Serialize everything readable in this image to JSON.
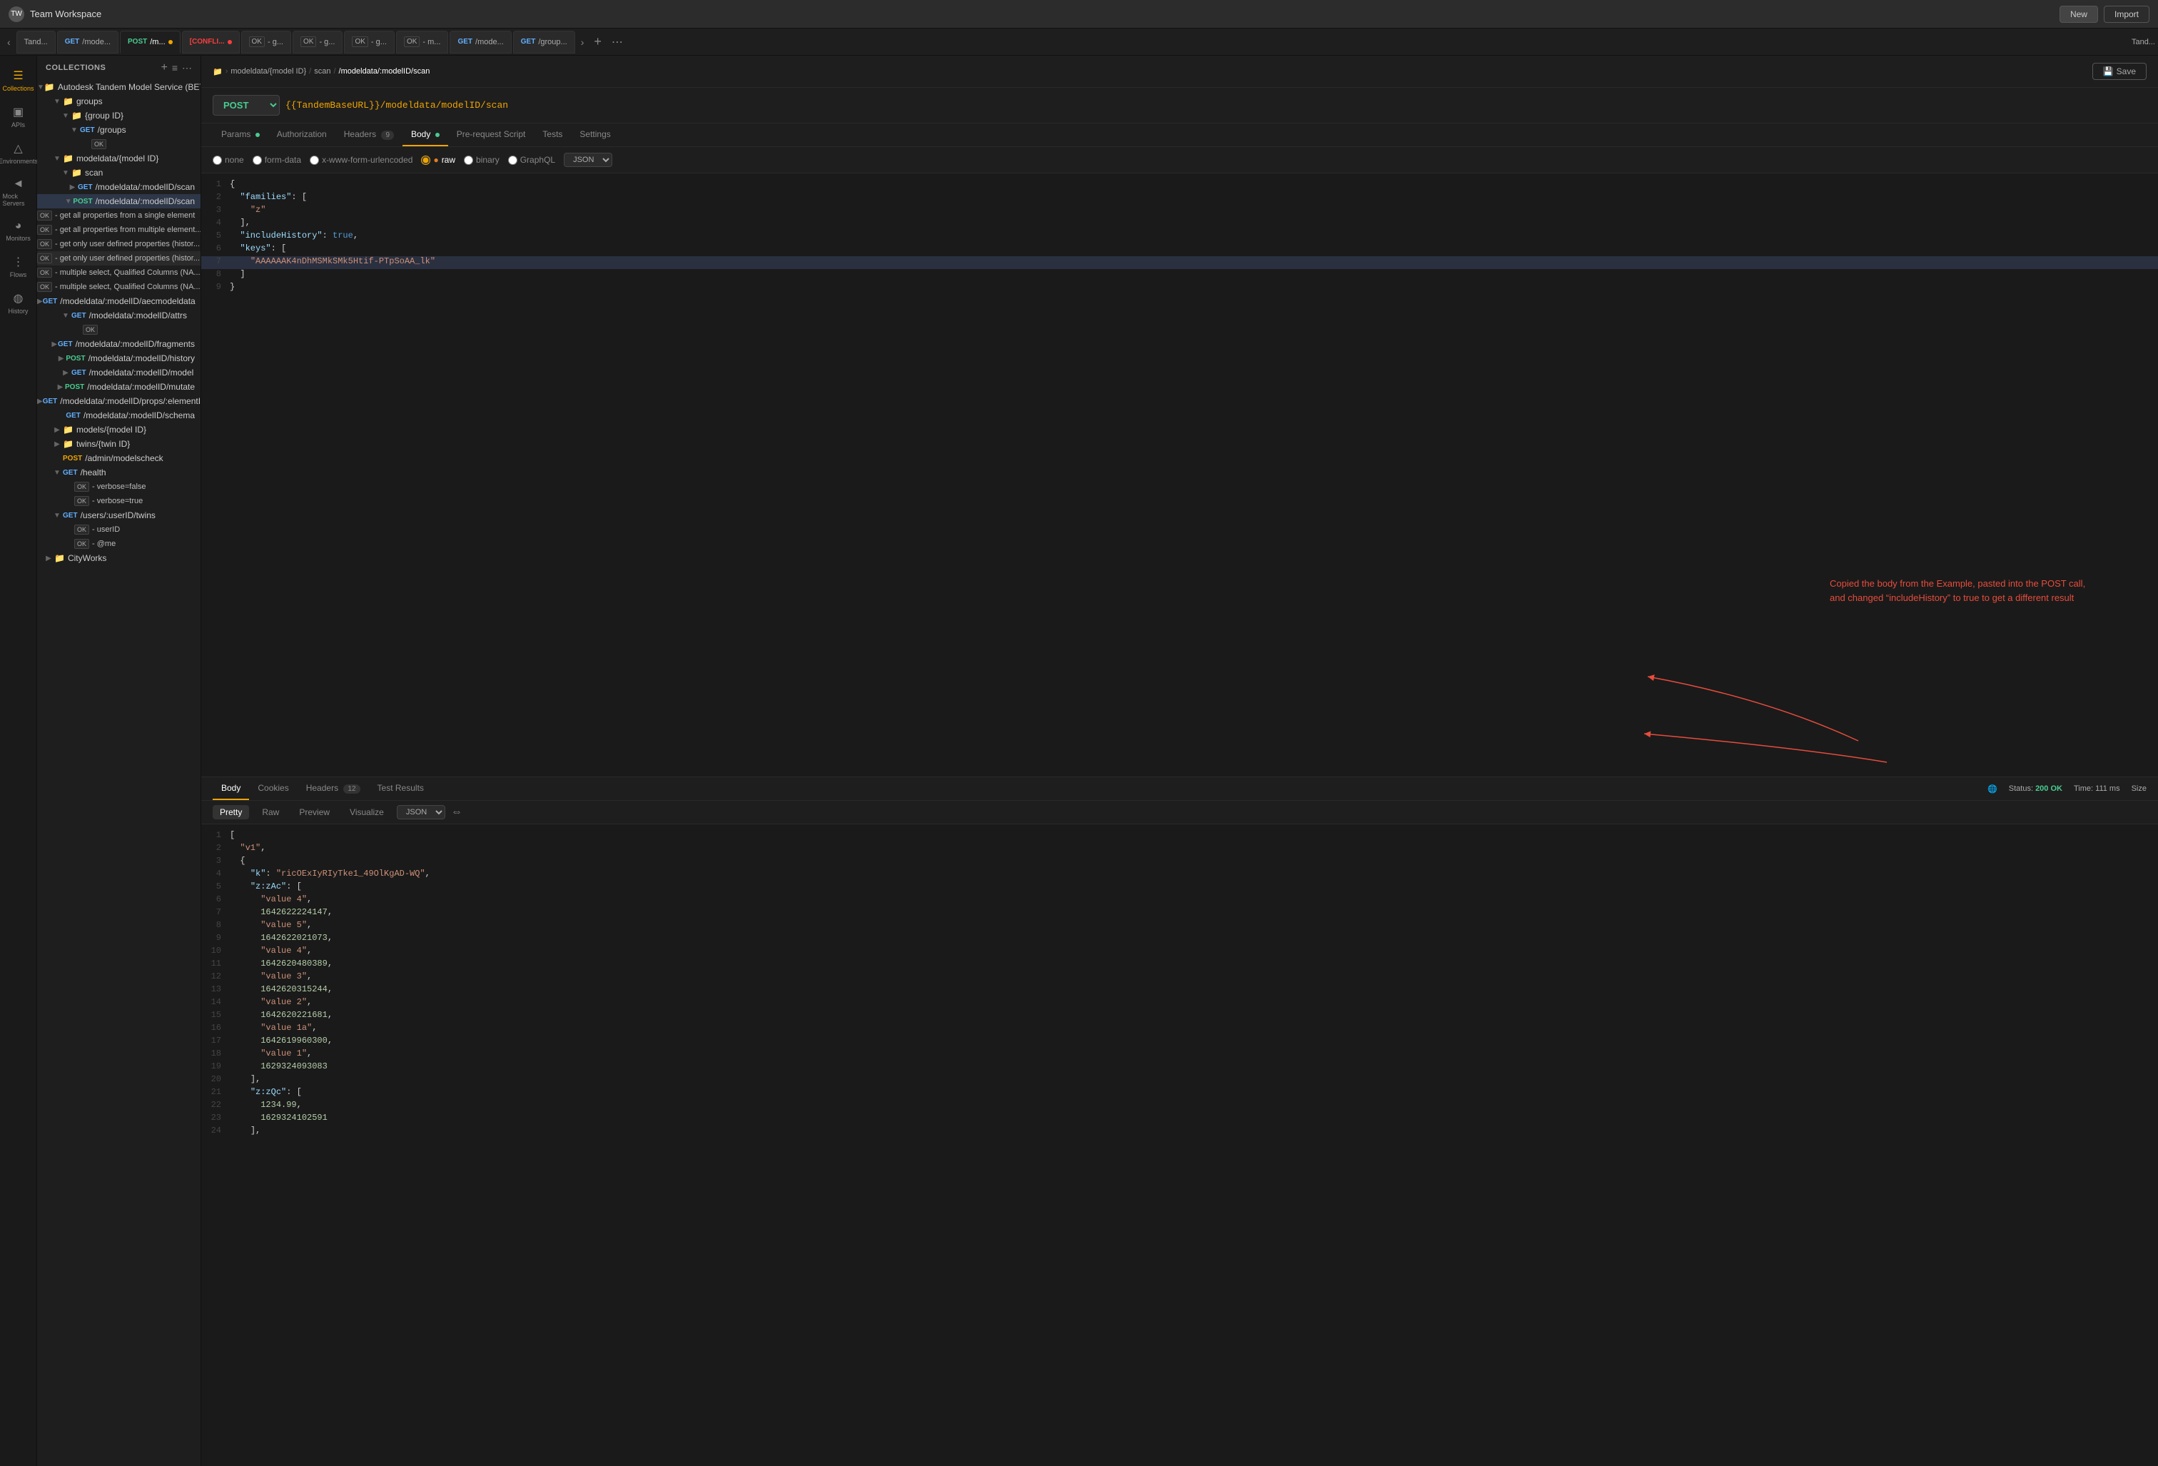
{
  "workspace": {
    "name": "Team Workspace",
    "icon": "TW"
  },
  "topbar": {
    "new_label": "New",
    "import_label": "Import"
  },
  "tabs": [
    {
      "id": "tand1",
      "label": "Tand...",
      "method": "",
      "active": false
    },
    {
      "id": "get1",
      "label": "/mode...",
      "method": "GET",
      "type": "get",
      "active": false
    },
    {
      "id": "post1",
      "label": "/m...",
      "method": "POST",
      "type": "post",
      "dot": true,
      "active": true
    },
    {
      "id": "conflict1",
      "label": "[CONFLI...",
      "method": "",
      "type": "conflict",
      "active": false
    },
    {
      "id": "ok1",
      "label": "OK - g...",
      "method": "",
      "active": false
    },
    {
      "id": "ok2",
      "label": "OK - g...",
      "method": "",
      "active": false
    },
    {
      "id": "ok3",
      "label": "OK - g...",
      "method": "",
      "active": false
    },
    {
      "id": "ok4",
      "label": "OK - m...",
      "method": "",
      "active": false
    },
    {
      "id": "get2",
      "label": "/mode...",
      "method": "GET",
      "type": "get",
      "active": false
    },
    {
      "id": "get3",
      "label": "/group...",
      "method": "GET",
      "type": "get",
      "active": false
    },
    {
      "id": "tand2",
      "label": "Tand...",
      "active": false
    }
  ],
  "sidebar": {
    "collections_label": "Collections",
    "apis_label": "APIs",
    "environments_label": "Environments",
    "mock_label": "Mock Servers",
    "monitors_label": "Monitors",
    "flows_label": "Flows",
    "history_label": "History"
  },
  "tree": {
    "title": "Collections",
    "root": "Autodesk Tandem Model Service (BETA)",
    "items": [
      {
        "id": "groups",
        "label": "groups",
        "type": "folder",
        "level": 1,
        "expanded": true
      },
      {
        "id": "group-id",
        "label": "{group ID}",
        "type": "folder",
        "level": 2,
        "expanded": true
      },
      {
        "id": "get-groups",
        "label": "/groups",
        "method": "GET",
        "level": 3,
        "expanded": true
      },
      {
        "id": "ok-groups",
        "label": "OK",
        "type": "ok",
        "level": 4
      },
      {
        "id": "modeldata",
        "label": "modeldata/{model ID}",
        "type": "folder",
        "level": 1,
        "expanded": true
      },
      {
        "id": "scan",
        "label": "scan",
        "type": "folder",
        "level": 2,
        "expanded": true
      },
      {
        "id": "get-scan",
        "label": "/modeldata/:modelID/scan",
        "method": "GET",
        "level": 3
      },
      {
        "id": "post-scan",
        "label": "/modeldata/:modelID/scan",
        "method": "POST",
        "level": 3,
        "selected": true,
        "expanded": true
      },
      {
        "id": "ok1",
        "label": "OK - get all properties from a single element",
        "type": "ok",
        "level": 4
      },
      {
        "id": "ok2",
        "label": "OK - get all properties from multiple element...",
        "type": "ok",
        "level": 4
      },
      {
        "id": "ok3",
        "label": "OK - get only user defined properties (histor...",
        "type": "ok",
        "level": 4
      },
      {
        "id": "ok4",
        "label": "OK - get only user defined properties (histor...",
        "type": "ok",
        "level": 4,
        "highlighted": true
      },
      {
        "id": "ok5",
        "label": "OK - multiple select, Qualified Columns (NA...",
        "type": "ok",
        "level": 4
      },
      {
        "id": "ok6",
        "label": "OK - multiple select, Qualified Columns (NA...",
        "type": "ok",
        "level": 4
      },
      {
        "id": "get-aec",
        "label": "/modeldata/:modelID/aecmodeldata",
        "method": "GET",
        "level": 2
      },
      {
        "id": "get-attrs",
        "label": "/modeldata/:modelID/attrs",
        "method": "GET",
        "level": 2,
        "expanded": true
      },
      {
        "id": "ok-attrs",
        "label": "OK",
        "type": "ok",
        "level": 3
      },
      {
        "id": "get-fragments",
        "label": "/modeldata/:modelID/fragments",
        "method": "GET",
        "level": 2
      },
      {
        "id": "post-history",
        "label": "/modeldata/:modelID/history",
        "method": "POST",
        "level": 2
      },
      {
        "id": "get-model",
        "label": "/modeldata/:modelID/model",
        "method": "GET",
        "level": 2
      },
      {
        "id": "post-mutate",
        "label": "/modeldata/:modelID/mutate",
        "method": "POST",
        "level": 2
      },
      {
        "id": "get-props",
        "label": "/modeldata/:modelID/props/:elementID",
        "method": "GET",
        "level": 2
      },
      {
        "id": "get-schema",
        "label": "/modeldata/:modelID/schema",
        "method": "GET",
        "level": 3
      },
      {
        "id": "models",
        "label": "models/{model ID}",
        "type": "folder",
        "level": 1
      },
      {
        "id": "twins",
        "label": "twins/{twin ID}",
        "type": "folder",
        "level": 1
      },
      {
        "id": "admin-check",
        "label": "/admin/modelscheck",
        "method": "POST",
        "level": 1,
        "color": "orange"
      },
      {
        "id": "get-health",
        "label": "/health",
        "method": "GET",
        "level": 1,
        "expanded": true
      },
      {
        "id": "ok-verbose-false",
        "label": "OK - verbose=false",
        "type": "ok",
        "level": 2
      },
      {
        "id": "ok-verbose-true",
        "label": "OK - verbose=true",
        "type": "ok",
        "level": 2
      },
      {
        "id": "get-users",
        "label": "/users/:userID/twins",
        "method": "GET",
        "level": 1,
        "expanded": true
      },
      {
        "id": "ok-userid",
        "label": "OK - userID",
        "type": "ok",
        "level": 2
      },
      {
        "id": "ok-me",
        "label": "OK - @me",
        "type": "ok",
        "level": 2
      },
      {
        "id": "cityworks",
        "label": "CityWorks",
        "type": "folder",
        "level": 0
      }
    ]
  },
  "request": {
    "method": "POST",
    "url": "{{TandemBaseURL}}/modeldata/modelID/scan",
    "breadcrumb": {
      "icon": "folder",
      "parts": [
        "modeldata/{model ID}",
        "scan",
        "/modeldata/:modelID/scan"
      ]
    },
    "tabs": [
      {
        "id": "params",
        "label": "Params",
        "dot": true
      },
      {
        "id": "auth",
        "label": "Authorization"
      },
      {
        "id": "headers",
        "label": "Headers",
        "badge": "9"
      },
      {
        "id": "body",
        "label": "Body",
        "dot": true,
        "active": true
      },
      {
        "id": "prerequest",
        "label": "Pre-request Script"
      },
      {
        "id": "tests",
        "label": "Tests"
      },
      {
        "id": "settings",
        "label": "Settings"
      }
    ],
    "body_options": [
      "none",
      "form-data",
      "x-www-form-urlencoded",
      "raw",
      "binary",
      "GraphQL"
    ],
    "body_active": "raw",
    "format": "JSON",
    "body_lines": [
      {
        "num": 1,
        "content": "{"
      },
      {
        "num": 2,
        "content": "  \"families\": ["
      },
      {
        "num": 3,
        "content": "    \"z\""
      },
      {
        "num": 4,
        "content": "  ],"
      },
      {
        "num": 5,
        "content": "  \"includeHistory\": true,"
      },
      {
        "num": 6,
        "content": "  \"keys\": ["
      },
      {
        "num": 7,
        "content": "    \"AAAAAAK4nDhMSMkSMk5Htif-PTpSoAA_lk\""
      },
      {
        "num": 8,
        "content": "  ]"
      },
      {
        "num": 9,
        "content": "}"
      }
    ]
  },
  "response": {
    "status": "200 OK",
    "time": "111 ms",
    "size": "Size",
    "tabs": [
      {
        "id": "body",
        "label": "Body",
        "active": true
      },
      {
        "id": "cookies",
        "label": "Cookies"
      },
      {
        "id": "headers",
        "label": "Headers",
        "badge": "12"
      },
      {
        "id": "test-results",
        "label": "Test Results"
      }
    ],
    "format_tabs": [
      "Pretty",
      "Raw",
      "Preview",
      "Visualize"
    ],
    "active_format": "Pretty",
    "format": "JSON",
    "lines": [
      {
        "num": 1,
        "content": "["
      },
      {
        "num": 2,
        "content": "  \"v1\","
      },
      {
        "num": 3,
        "content": "  {"
      },
      {
        "num": 4,
        "content": "    \"k\": \"ricOExIyRIyTke1_49OlKgAD-WQ\","
      },
      {
        "num": 5,
        "content": "    \"z:zAc\": ["
      },
      {
        "num": 6,
        "content": "      \"value 4\","
      },
      {
        "num": 7,
        "content": "      1642622224147,"
      },
      {
        "num": 8,
        "content": "      \"value 5\","
      },
      {
        "num": 9,
        "content": "      1642622021073,"
      },
      {
        "num": 10,
        "content": "      \"value 4\","
      },
      {
        "num": 11,
        "content": "      1642620480389,"
      },
      {
        "num": 12,
        "content": "      \"value 3\","
      },
      {
        "num": 13,
        "content": "      1642620315244,"
      },
      {
        "num": 14,
        "content": "      \"value 2\","
      },
      {
        "num": 15,
        "content": "      1642620221681,"
      },
      {
        "num": 16,
        "content": "      \"value 1a\","
      },
      {
        "num": 17,
        "content": "      1642619960300,"
      },
      {
        "num": 18,
        "content": "      \"value 1\","
      },
      {
        "num": 19,
        "content": "      1629324093083"
      },
      {
        "num": 20,
        "content": "    ],"
      },
      {
        "num": 21,
        "content": "    \"z:zQc\": ["
      },
      {
        "num": 22,
        "content": "      1234.99,"
      },
      {
        "num": 23,
        "content": "      1629324102591"
      },
      {
        "num": 24,
        "content": "    ],"
      }
    ]
  },
  "annotation": {
    "text": "Copied the body from the Example, pasted into the POST call, and changed “includeHistory” to true to get a different result"
  }
}
